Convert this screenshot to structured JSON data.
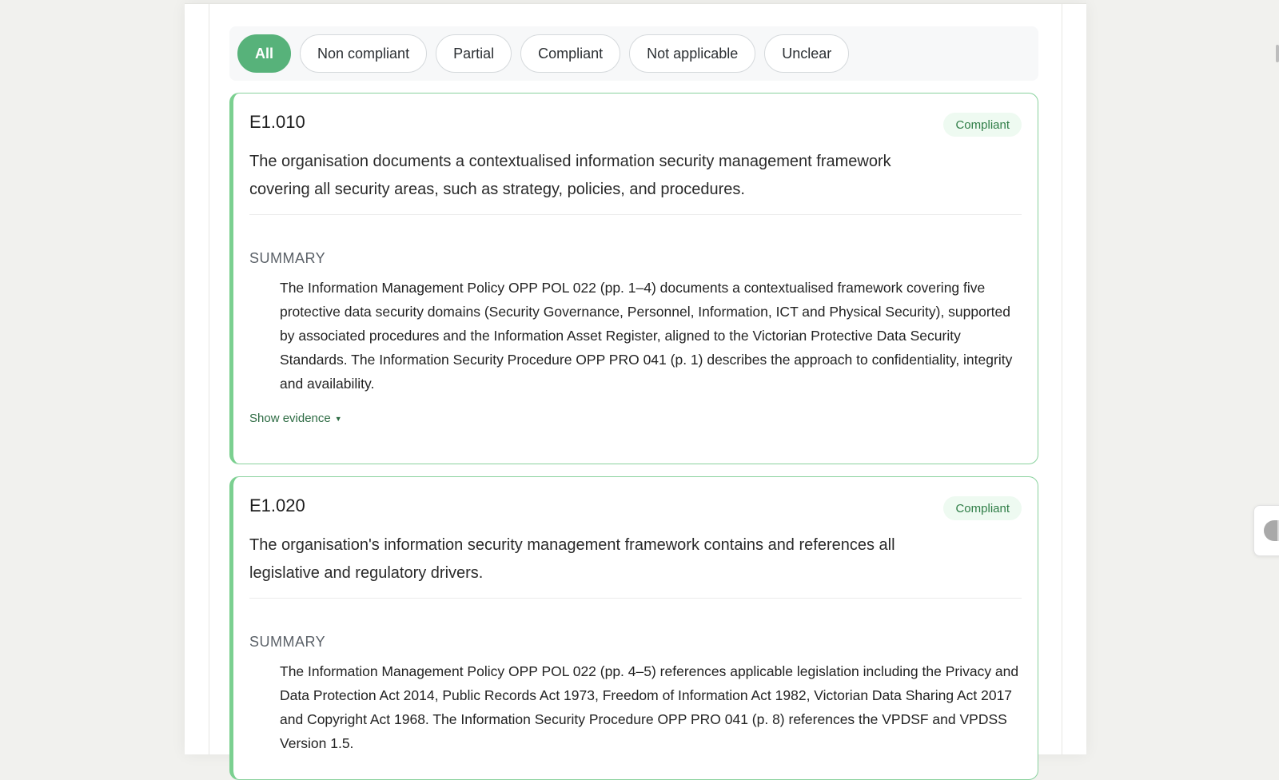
{
  "filters": {
    "active": "All",
    "items": [
      {
        "label": "All"
      },
      {
        "label": "Non compliant"
      },
      {
        "label": "Partial"
      },
      {
        "label": "Compliant"
      },
      {
        "label": "Not applicable"
      },
      {
        "label": "Unclear"
      }
    ]
  },
  "cards": [
    {
      "id": "E1.010",
      "status": "Compliant",
      "requirement": "The organisation documents a contextualised information security management framework covering all security areas, such as strategy, policies, and procedures.",
      "summary_label": "SUMMARY",
      "summary": "The Information Management Policy OPP POL 022 (pp. 1–4) documents a contextualised framework covering five protective data security domains (Security Governance, Personnel, Information, ICT and Physical Security), supported by associated procedures and the Information Asset Register, aligned to the Victorian Protective Data Security Standards. The Information Security Procedure OPP PRO 041 (p. 1) describes the approach to confidentiality, integrity and availability.",
      "show_evidence": "Show evidence"
    },
    {
      "id": "E1.020",
      "status": "Compliant",
      "requirement": "The organisation's information security management framework contains and references all legislative and regulatory drivers.",
      "summary_label": "SUMMARY",
      "summary": "The Information Management Policy OPP POL 022 (pp. 4–5) references applicable legislation including the Privacy and Data Protection Act 2014, Public Records Act 1973, Freedom of Information Act 1982, Victorian Data Sharing Act 2017 and Copyright Act 1968. The Information Security Procedure OPP PRO 041 (p. 8) references the VPDSF and VPDSS Version 1.5."
    }
  ],
  "colors": {
    "accent": "#57b27a",
    "card_border": "#7bd090",
    "badge_bg": "#eefaf1",
    "badge_text": "#2e7d46"
  },
  "icons": {
    "caret": "caret-down-icon",
    "side_tab": "collapse-panel-icon"
  }
}
